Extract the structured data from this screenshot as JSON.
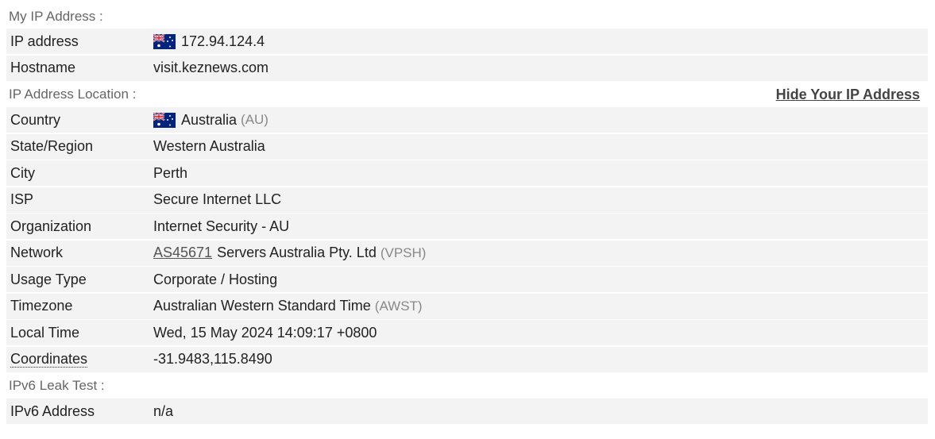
{
  "sections": {
    "my_ip": {
      "title": "My IP Address :",
      "ip_address_label": "IP address",
      "ip_address_value": "172.94.124.4",
      "hostname_label": "Hostname",
      "hostname_value": "visit.keznews.com"
    },
    "location": {
      "title": "IP Address Location :",
      "hide_link": "Hide Your IP Address",
      "country_label": "Country",
      "country_value": "Australia",
      "country_code": "(AU)",
      "state_label": "State/Region",
      "state_value": "Western Australia",
      "city_label": "City",
      "city_value": "Perth",
      "isp_label": "ISP",
      "isp_value": "Secure Internet LLC",
      "org_label": "Organization",
      "org_value": "Internet Security - AU",
      "network_label": "Network",
      "network_asn": "AS45671",
      "network_name": "Servers Australia Pty. Ltd",
      "network_tag": "(VPSH)",
      "usage_label": "Usage Type",
      "usage_value": "Corporate / Hosting",
      "timezone_label": "Timezone",
      "timezone_value": "Australian Western Standard Time",
      "timezone_abbr": "(AWST)",
      "localtime_label": "Local Time",
      "localtime_value": "Wed, 15 May 2024 14:09:17 +0800",
      "coords_label": "Coordinates",
      "coords_value": "-31.9483,115.8490"
    },
    "ipv6": {
      "title": "IPv6 Leak Test :",
      "ipv6_label": "IPv6 Address",
      "ipv6_value": "n/a"
    }
  },
  "icons": {
    "flag": "australia-flag-icon"
  },
  "colors": {
    "row_bg": "#f3f3f3",
    "section_text": "#666666",
    "flag_blue": "#00247d",
    "flag_red": "#cf142b"
  }
}
